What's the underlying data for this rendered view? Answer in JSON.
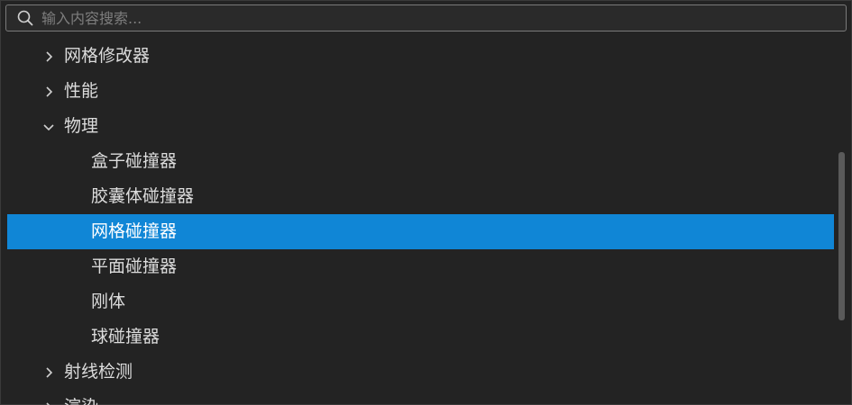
{
  "search": {
    "placeholder": "输入内容搜索...",
    "value": ""
  },
  "tree": {
    "items": [
      {
        "label": "网格修改器",
        "expanded": false,
        "level": 0
      },
      {
        "label": "性能",
        "expanded": false,
        "level": 0
      },
      {
        "label": "物理",
        "expanded": true,
        "level": 0
      },
      {
        "label": "盒子碰撞器",
        "level": 1
      },
      {
        "label": "胶囊体碰撞器",
        "level": 1
      },
      {
        "label": "网格碰撞器",
        "level": 1,
        "selected": true
      },
      {
        "label": "平面碰撞器",
        "level": 1
      },
      {
        "label": "刚体",
        "level": 1
      },
      {
        "label": "球碰撞器",
        "level": 1
      },
      {
        "label": "射线检测",
        "expanded": false,
        "level": 0
      },
      {
        "label": "渲染",
        "expanded": false,
        "level": 0
      }
    ]
  },
  "colors": {
    "background": "#232323",
    "selection": "#1086d6",
    "text": "#dcdcdc",
    "scrollbar": "#5a5a5a"
  }
}
